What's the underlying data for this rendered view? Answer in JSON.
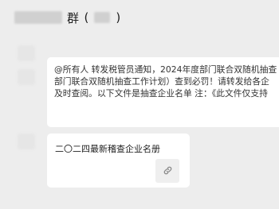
{
  "header": {
    "group_label": "群",
    "left_paren": "(",
    "right_paren": ")"
  },
  "messages": [
    {
      "lines": [
        "@所有人 转发税管员通知，2024年度部门联合双随机抽查",
        "部门联合双随机抽查工作计划）查到必罚！请转发给各企",
        "及时查阅。以下文件是抽查企业名单 注：《此文件仅支持"
      ]
    }
  ],
  "file_card": {
    "file_name": "二〇二四最新稽查企业名册",
    "icon": "link-icon"
  },
  "colors": {
    "background": "#ededed",
    "bubble": "#ffffff",
    "text": "#333333",
    "link_box": "#efefef"
  }
}
